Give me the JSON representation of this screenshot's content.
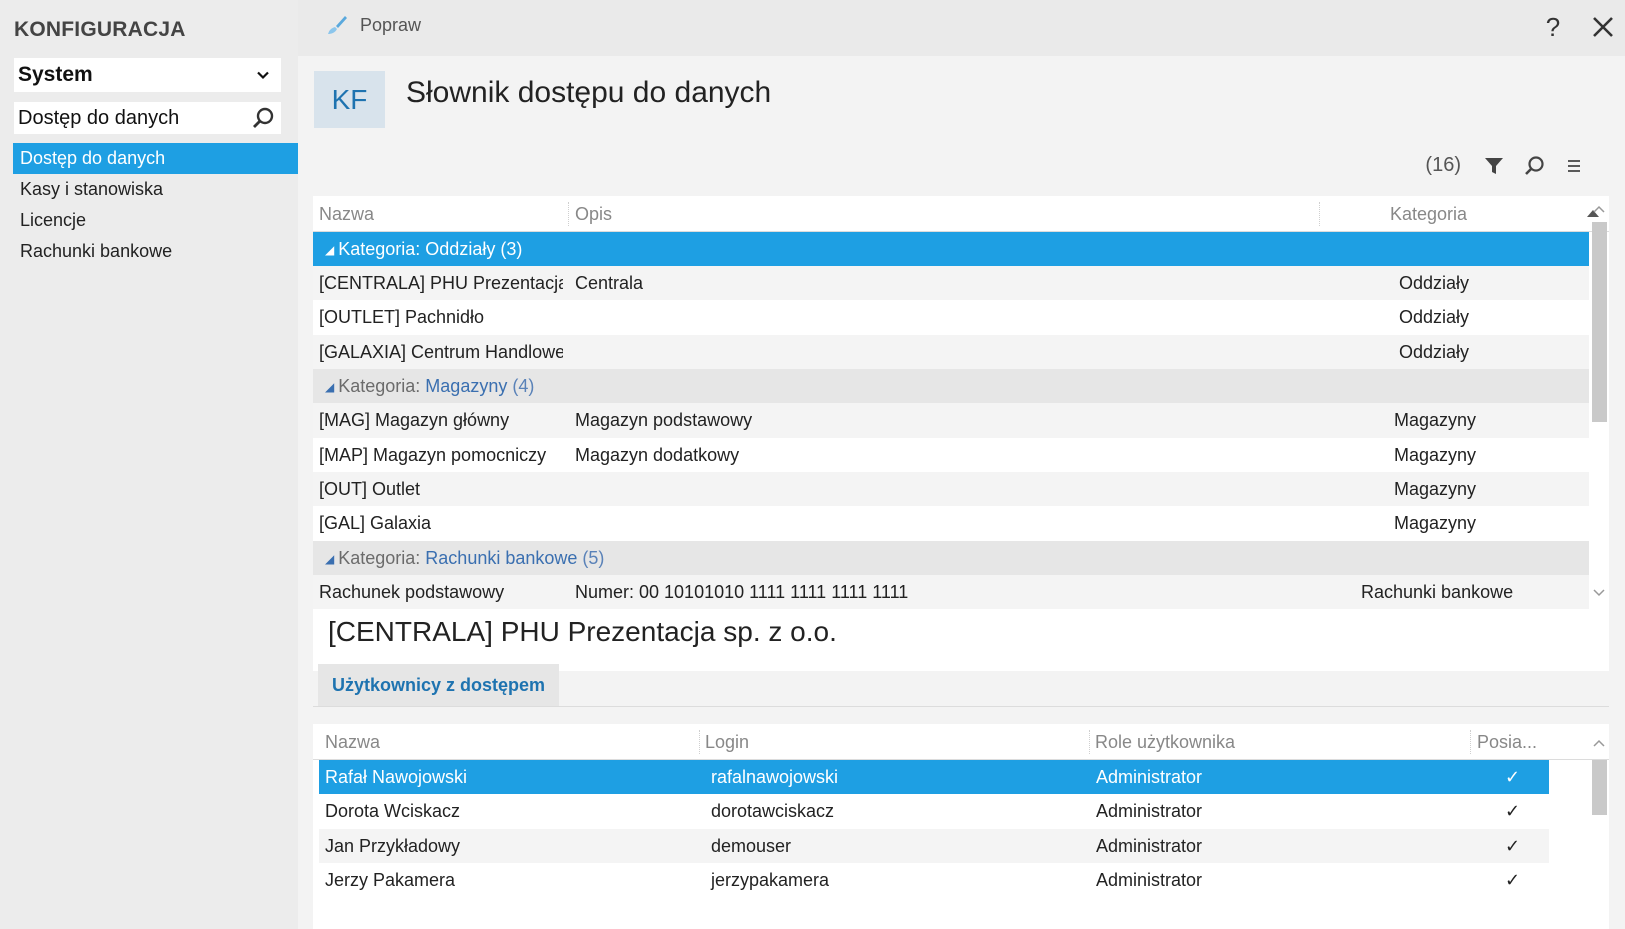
{
  "sidebar": {
    "app_title": "KONFIGURACJA",
    "module": "System",
    "search_value": "Dostęp do danych",
    "items": [
      {
        "label": "Dostęp do danych",
        "active": true
      },
      {
        "label": "Kasy i stanowiska",
        "active": false
      },
      {
        "label": "Licencje",
        "active": false
      },
      {
        "label": "Rachunki bankowe",
        "active": false
      }
    ]
  },
  "topbar": {
    "edit_label": "Popraw",
    "help_label": "?"
  },
  "header": {
    "badge": "KF",
    "title": "Słownik dostępu do danych"
  },
  "grid": {
    "count": "(16)",
    "columns": {
      "name": "Nazwa",
      "desc": "Opis",
      "category": "Kategoria"
    },
    "group_prefix": "Kategoria: ",
    "groups": [
      {
        "label": "Oddziały",
        "count": "(3)",
        "rows": [
          {
            "name": "[CENTRALA] PHU Prezentacja...",
            "desc": "Centrala",
            "category": "Oddziały"
          },
          {
            "name": "[OUTLET] Pachnidło",
            "desc": "",
            "category": "Oddziały"
          },
          {
            "name": "[GALAXIA] Centrum Handlowe",
            "desc": "",
            "category": "Oddziały"
          }
        ]
      },
      {
        "label": "Magazyny",
        "count": "(4)",
        "rows": [
          {
            "name": "[MAG] Magazyn główny",
            "desc": "Magazyn podstawowy",
            "category": "Magazyny"
          },
          {
            "name": "[MAP] Magazyn pomocniczy",
            "desc": "Magazyn dodatkowy",
            "category": "Magazyny"
          },
          {
            "name": "[OUT] Outlet",
            "desc": "",
            "category": "Magazyny"
          },
          {
            "name": "[GAL] Galaxia",
            "desc": "",
            "category": "Magazyny"
          }
        ]
      },
      {
        "label": "Rachunki bankowe",
        "count": "(5)",
        "rows": [
          {
            "name": "Rachunek podstawowy",
            "desc": "Numer: 00 10101010 1111 1111 1111 1111",
            "category": "Rachunki bankowe"
          }
        ]
      }
    ]
  },
  "detail": {
    "title": "[CENTRALA] PHU Prezentacja sp. z o.o.",
    "tab_label": "Użytkownicy z dostępem",
    "columns": {
      "name": "Nazwa",
      "login": "Login",
      "roles": "Role użytkownika",
      "access": "Posia..."
    },
    "users": [
      {
        "name": "Rafał Nawojowski",
        "login": "rafalnawojowski",
        "role": "Administrator",
        "check": "✓"
      },
      {
        "name": "Dorota Wciskacz",
        "login": "dorotawciskacz",
        "role": "Administrator",
        "check": "✓"
      },
      {
        "name": "Jan Przykładowy",
        "login": "demouser",
        "role": "Administrator",
        "check": "✓"
      },
      {
        "name": "Jerzy Pakamera",
        "login": "jerzypakamera",
        "role": "Administrator",
        "check": "✓"
      }
    ]
  },
  "colors": {
    "accent": "#1e9fe3",
    "badge_bg": "#d8e3ec",
    "badge_fg": "#1e73b0"
  }
}
